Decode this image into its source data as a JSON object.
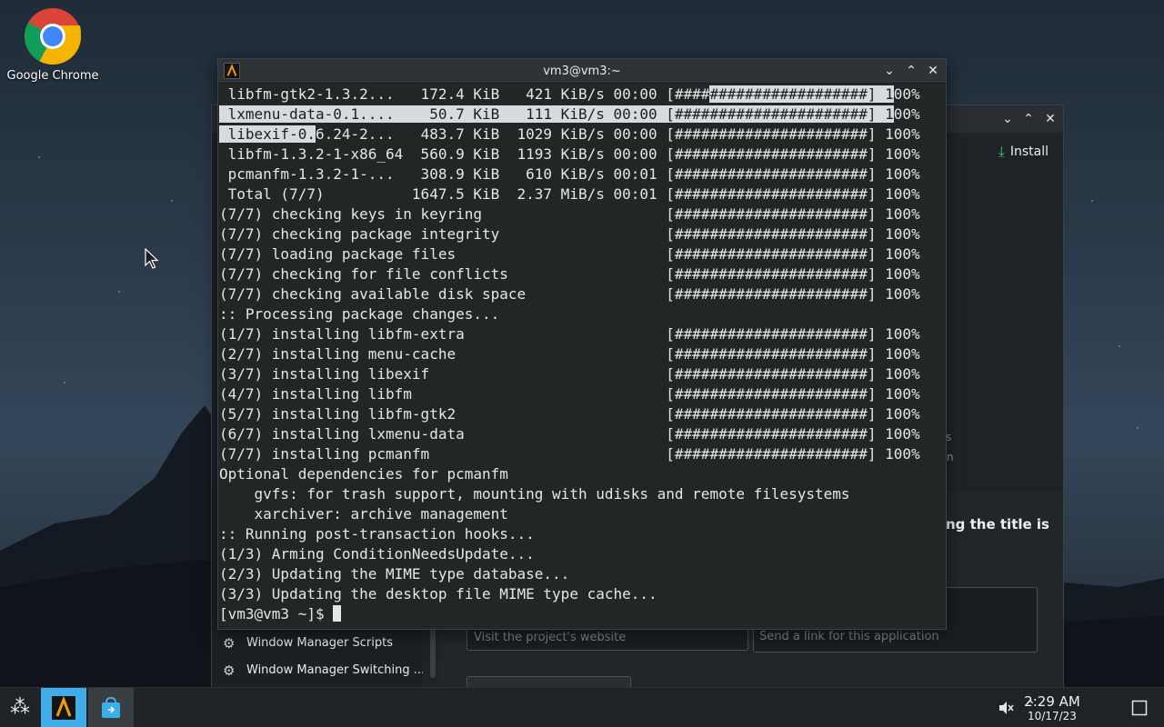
{
  "desktop": {
    "icon_label": "Google Chrome"
  },
  "background_window": {
    "install_label": "Install",
    "sidebar_items": [
      "Window Manager Scripts",
      "Window Manager Switching ..."
    ],
    "fragment_text": "ng the title is",
    "website_placeholder": "Visit the project's website",
    "link_placeholder": "Send a link for this application",
    "edge_fragment_1": "s",
    "edge_fragment_2": "n"
  },
  "terminal": {
    "title": "vm3@vm3:~",
    "lines": [
      " libfm-gtk2-1.3.2...   172.4 KiB   421 KiB/s 00:00 [######################] 100%",
      " lxmenu-data-0.1....    50.7 KiB   111 KiB/s 00:00 [######################] 100%",
      " libexif-0.6.24-2...   483.7 KiB  1029 KiB/s 00:00 [######################] 100%",
      " libfm-1.3.2-1-x86_64  560.9 KiB  1193 KiB/s 00:00 [######################] 100%",
      " pcmanfm-1.3.2-1-...   308.9 KiB   610 KiB/s 00:01 [######################] 100%",
      " Total (7/7)          1647.5 KiB  2.37 MiB/s 00:01 [######################] 100%",
      "(7/7) checking keys in keyring                     [######################] 100%",
      "(7/7) checking package integrity                   [######################] 100%",
      "(7/7) loading package files                        [######################] 100%",
      "(7/7) checking for file conflicts                  [######################] 100%",
      "(7/7) checking available disk space                [######################] 100%",
      ":: Processing package changes...",
      "(1/7) installing libfm-extra                       [######################] 100%",
      "(2/7) installing menu-cache                        [######################] 100%",
      "(3/7) installing libexif                           [######################] 100%",
      "(4/7) installing libfm                             [######################] 100%",
      "(5/7) installing libfm-gtk2                        [######################] 100%",
      "(6/7) installing lxmenu-data                       [######################] 100%",
      "(7/7) installing pcmanfm                           [######################] 100%",
      "Optional dependencies for pcmanfm",
      "    gvfs: for trash support, mounting with udisks and remote filesystems",
      "    xarchiver: archive management",
      ":: Running post-transaction hooks...",
      "(1/3) Arming ConditionNeedsUpdate...",
      "(2/3) Updating the MIME type database...",
      "(3/3) Updating the desktop file MIME type cache..."
    ],
    "prompt": "[vm3@vm3 ~]$ "
  },
  "taskbar": {
    "time": "2:29 AM",
    "date": "10/17/23"
  },
  "colors": {
    "accent": "#3daee9",
    "terminal_bg": "#232627",
    "selection": "#d7dbe0"
  }
}
